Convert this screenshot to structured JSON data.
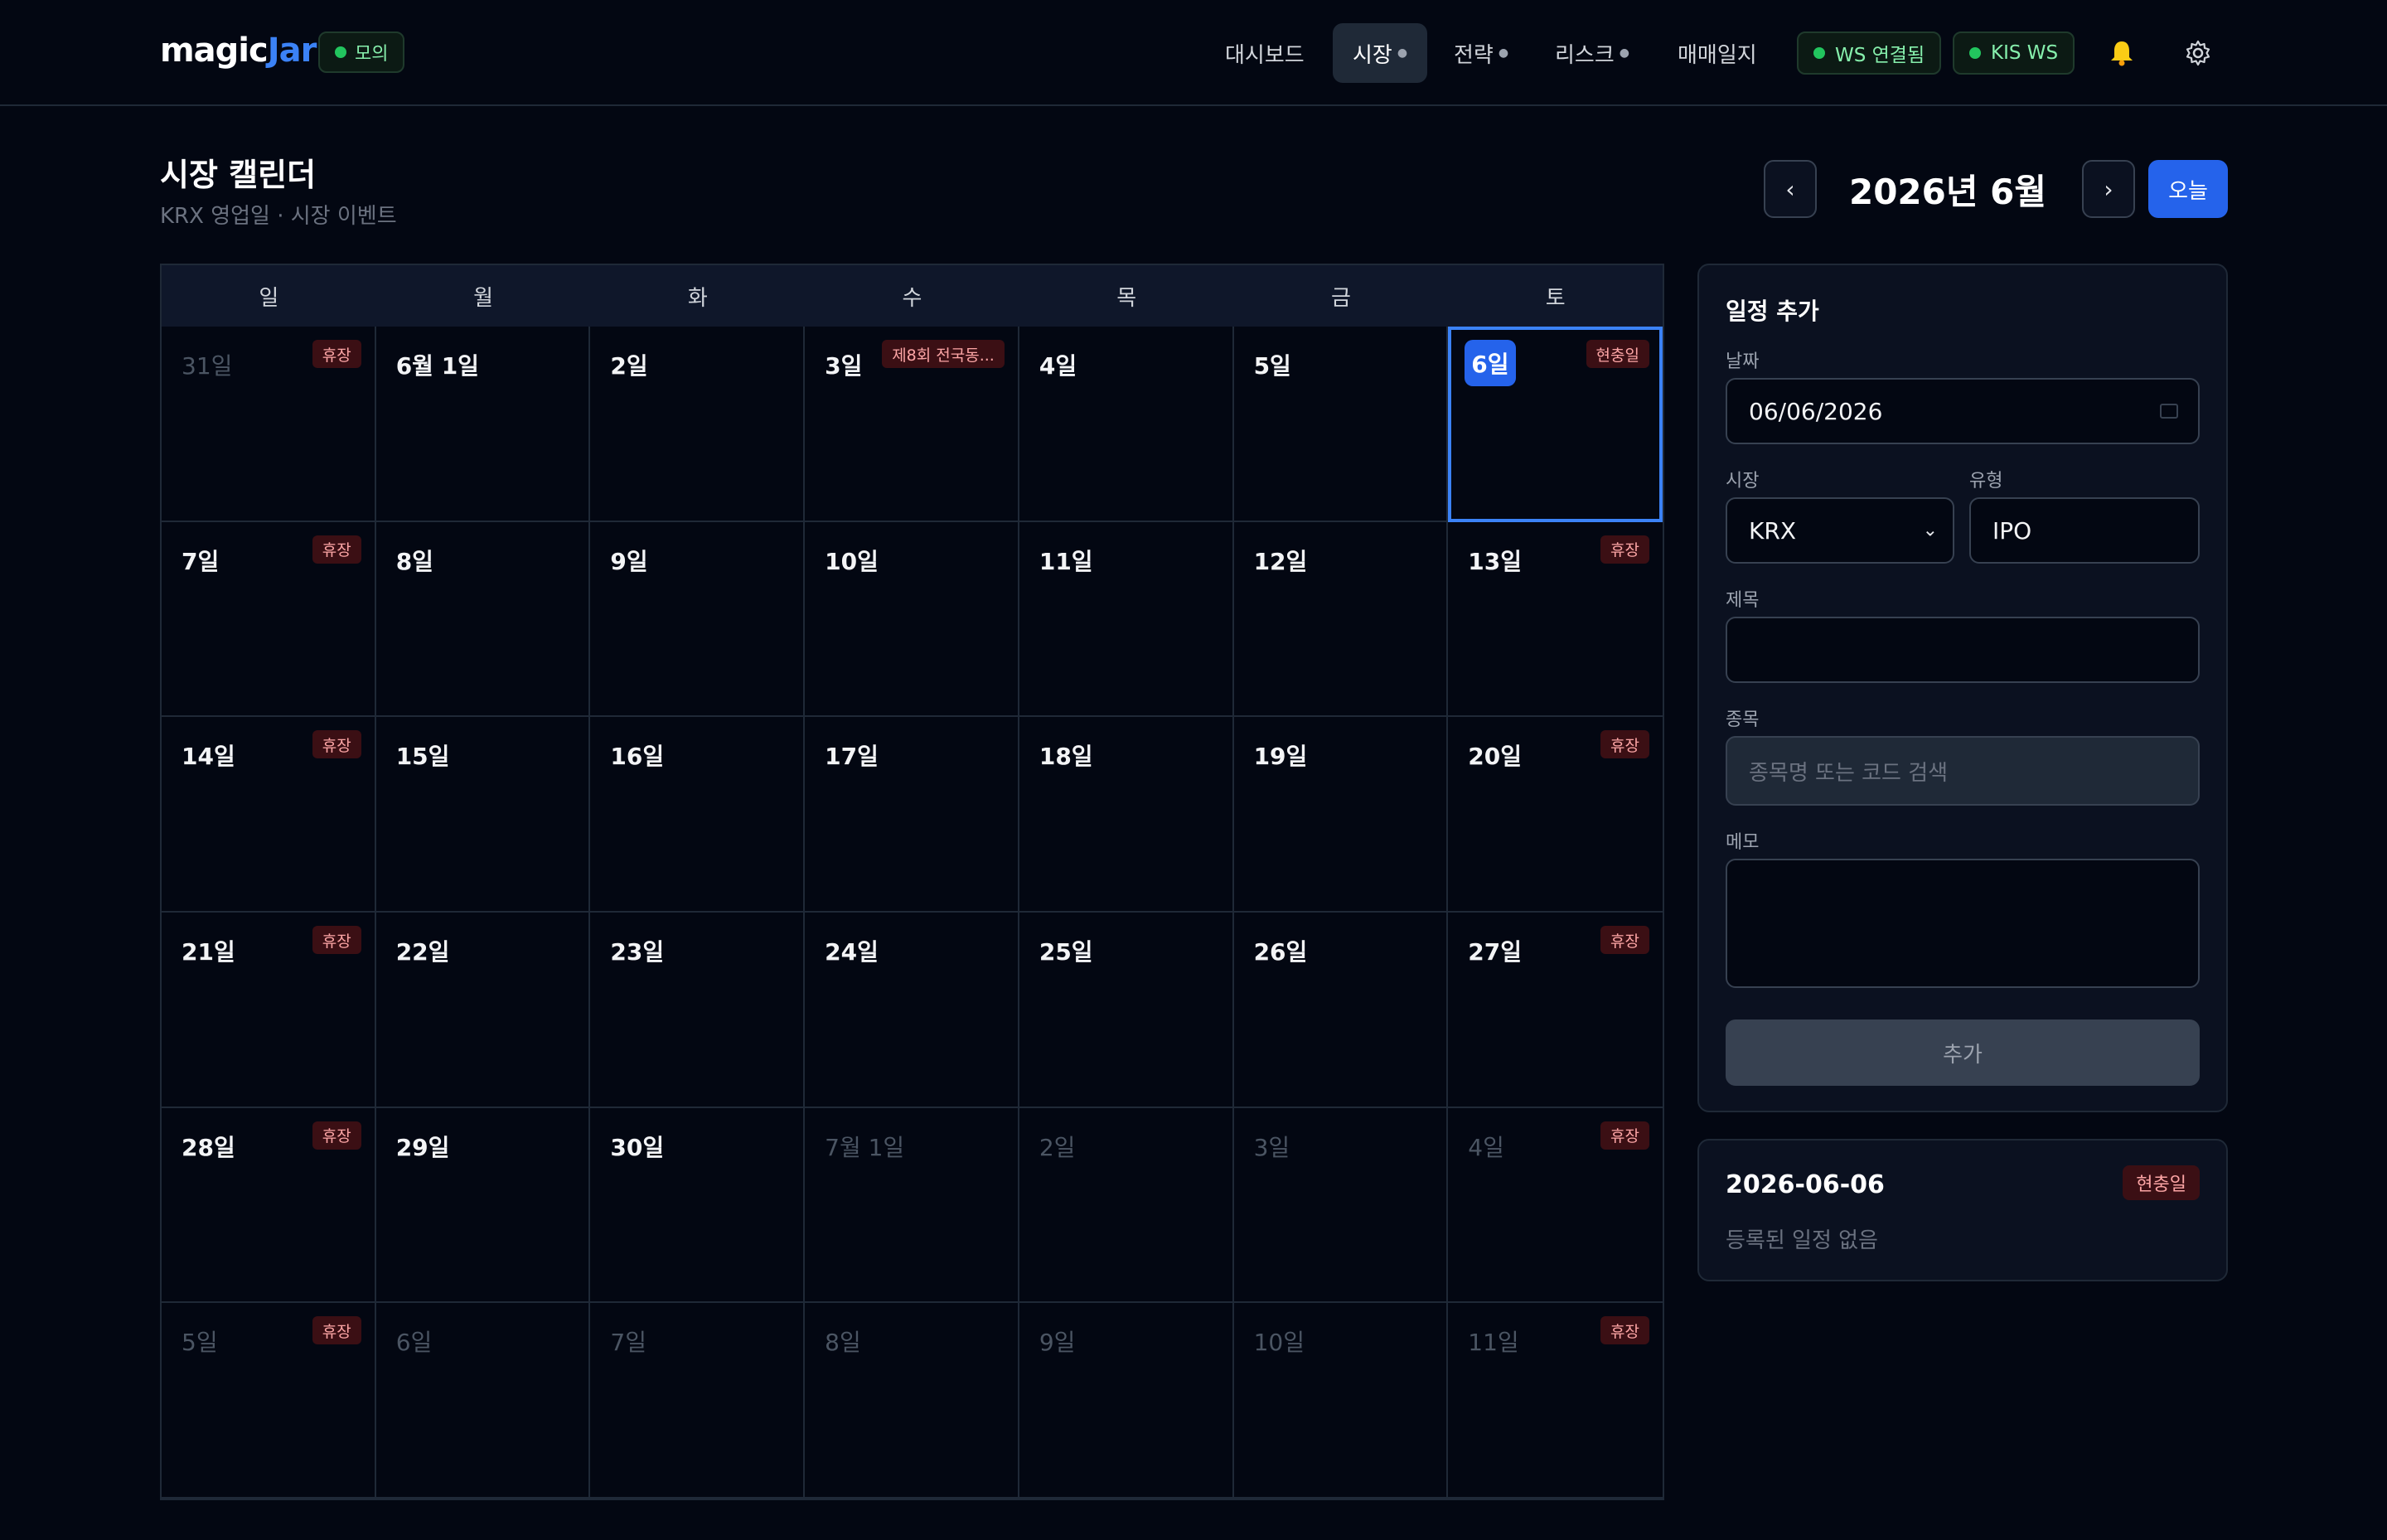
{
  "header": {
    "brand_main": "magic",
    "brand_accent": "Jar",
    "mode_badge": "모의",
    "nav": [
      {
        "label": "대시보드",
        "has_caret": false
      },
      {
        "label": "시장",
        "has_caret": true,
        "active": true
      },
      {
        "label": "전략",
        "has_caret": true
      },
      {
        "label": "리스크",
        "has_caret": true
      },
      {
        "label": "매매일지",
        "has_caret": false
      }
    ],
    "ws_badge": "WS 연결됨",
    "kis_badge": "KIS WS",
    "icons": [
      "bell-icon",
      "gear-icon"
    ]
  },
  "page": {
    "title": "시장 캘린더",
    "subtitle": "KRX 영업일 · 시장 이벤트"
  },
  "month_nav": {
    "prev": "‹",
    "label": "2026년 6월",
    "next": "›",
    "today": "오늘"
  },
  "calendar": {
    "weekdays": [
      "일",
      "월",
      "화",
      "수",
      "목",
      "금",
      "토"
    ],
    "cells": [
      {
        "day": "31일",
        "muted": true,
        "tag": "휴장"
      },
      {
        "day": "6월 1일"
      },
      {
        "day": "2일"
      },
      {
        "day": "3일",
        "tag": "제8회 전국동..."
      },
      {
        "day": "4일"
      },
      {
        "day": "5일"
      },
      {
        "day": "6일",
        "selected": true,
        "tag": "현충일"
      },
      {
        "day": "7일",
        "tag": "휴장"
      },
      {
        "day": "8일"
      },
      {
        "day": "9일"
      },
      {
        "day": "10일"
      },
      {
        "day": "11일"
      },
      {
        "day": "12일"
      },
      {
        "day": "13일",
        "tag": "휴장"
      },
      {
        "day": "14일",
        "tag": "휴장"
      },
      {
        "day": "15일"
      },
      {
        "day": "16일"
      },
      {
        "day": "17일"
      },
      {
        "day": "18일"
      },
      {
        "day": "19일"
      },
      {
        "day": "20일",
        "tag": "휴장"
      },
      {
        "day": "21일",
        "tag": "휴장"
      },
      {
        "day": "22일"
      },
      {
        "day": "23일"
      },
      {
        "day": "24일"
      },
      {
        "day": "25일"
      },
      {
        "day": "26일"
      },
      {
        "day": "27일",
        "tag": "휴장"
      },
      {
        "day": "28일",
        "tag": "휴장"
      },
      {
        "day": "29일"
      },
      {
        "day": "30일"
      },
      {
        "day": "7월 1일",
        "muted": true
      },
      {
        "day": "2일",
        "muted": true
      },
      {
        "day": "3일",
        "muted": true
      },
      {
        "day": "4일",
        "muted": true,
        "tag": "휴장"
      },
      {
        "day": "5일",
        "muted": true,
        "tag": "휴장"
      },
      {
        "day": "6일",
        "muted": true
      },
      {
        "day": "7일",
        "muted": true
      },
      {
        "day": "8일",
        "muted": true
      },
      {
        "day": "9일",
        "muted": true
      },
      {
        "day": "10일",
        "muted": true
      },
      {
        "day": "11일",
        "muted": true,
        "tag": "휴장"
      }
    ]
  },
  "form": {
    "title": "일정 추가",
    "date_label": "날짜",
    "date_value": "06/06/2026",
    "market_label": "시장",
    "market_value": "KRX",
    "type_label": "유형",
    "type_value": "IPO",
    "subject_label": "제목",
    "subject_value": "",
    "stock_label": "종목",
    "stock_placeholder": "종목명 또는 코드 검색",
    "memo_label": "메모",
    "memo_value": "",
    "submit": "추가"
  },
  "summary": {
    "date": "2026-06-06",
    "tag": "현충일",
    "empty": "등록된 일정 없음"
  }
}
